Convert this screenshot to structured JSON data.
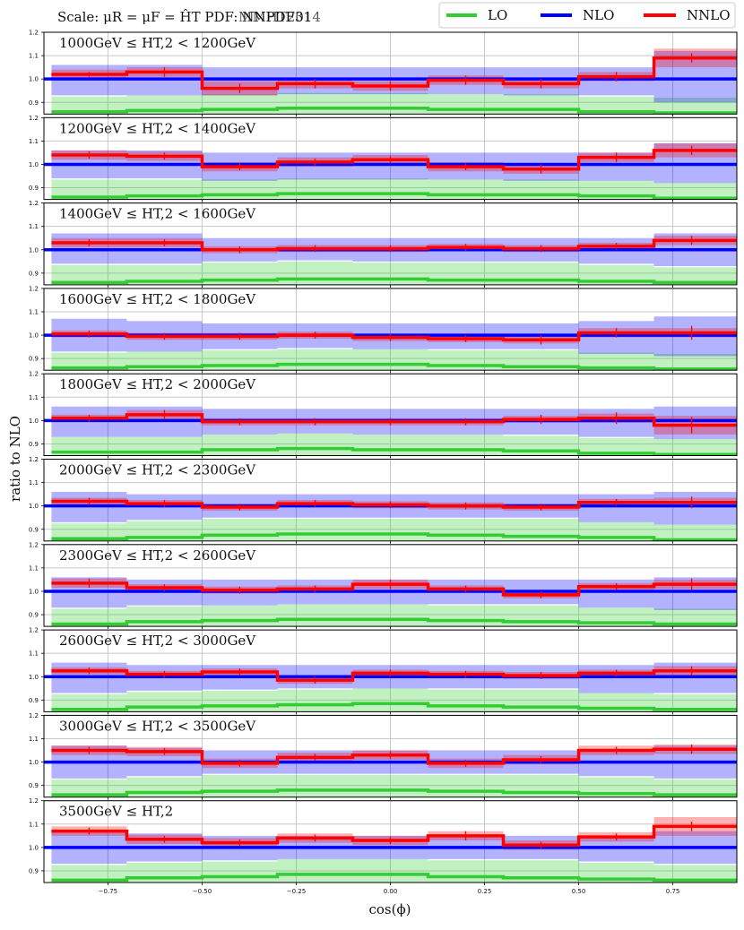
{
  "header": {
    "scale_text": "Scale: μR = μF = ĤT PDF: NNPDF31",
    "pdf_overlay": "MMHT2014"
  },
  "legend": {
    "placement": "top-right",
    "entries": [
      {
        "label": "LO",
        "color": "#33cc33"
      },
      {
        "label": "NLO",
        "color": "#0000ff"
      },
      {
        "label": "NNLO",
        "color": "#ff0000"
      }
    ]
  },
  "chart_data": {
    "type": "line",
    "xlabel": "cos(ϕ)",
    "ylabel": "ratio to NLO",
    "xlim": [
      -0.92,
      0.92
    ],
    "ylim": [
      0.85,
      1.2
    ],
    "yticks": [
      0.9,
      1.0,
      1.1,
      1.2
    ],
    "xticks": [
      -0.75,
      -0.5,
      -0.25,
      0.0,
      0.25,
      0.5,
      0.75
    ],
    "xtick_labels": [
      "−0.75",
      "−0.50",
      "−0.25",
      "0.00",
      "0.25",
      "0.50",
      "0.75"
    ],
    "grid": true,
    "bin_edges": [
      -0.9,
      -0.7,
      -0.5,
      -0.3,
      -0.1,
      0.1,
      0.3,
      0.5,
      0.7,
      0.92
    ],
    "bin_centers": [
      -0.8,
      -0.6,
      -0.4,
      -0.2,
      0.0,
      0.2,
      0.4,
      0.6,
      0.8
    ],
    "panels": [
      {
        "label": "1000GeV ≤ HT,2 < 1200GeV",
        "lo": [
          0.86,
          0.865,
          0.87,
          0.875,
          0.875,
          0.87,
          0.87,
          0.86,
          0.855
        ],
        "nlo_band_lo": [
          0.93,
          0.93,
          0.93,
          0.935,
          0.935,
          0.935,
          0.93,
          0.93,
          0.9
        ],
        "nlo_band_hi": [
          1.06,
          1.06,
          1.05,
          1.05,
          1.05,
          1.05,
          1.05,
          1.05,
          1.12
        ],
        "nnlo": [
          1.02,
          1.03,
          0.96,
          0.98,
          0.97,
          0.995,
          0.98,
          1.01,
          1.09
        ],
        "nnlo_err": [
          0.01,
          0.02,
          0.02,
          0.02,
          0.02,
          0.02,
          0.02,
          0.02,
          0.02
        ],
        "nnlo_band": [
          0.02,
          0.02,
          0.03,
          0.02,
          0.02,
          0.02,
          0.02,
          0.02,
          0.04
        ]
      },
      {
        "label": "1200GeV ≤ HT,2 < 1400GeV",
        "lo": [
          0.86,
          0.865,
          0.87,
          0.875,
          0.875,
          0.87,
          0.87,
          0.865,
          0.855
        ],
        "nlo_band_lo": [
          0.94,
          0.94,
          0.93,
          0.935,
          0.935,
          0.935,
          0.93,
          0.93,
          0.92
        ],
        "nlo_band_hi": [
          1.06,
          1.06,
          1.05,
          1.05,
          1.05,
          1.05,
          1.05,
          1.05,
          1.09
        ],
        "nnlo": [
          1.04,
          1.035,
          0.99,
          1.01,
          1.02,
          0.99,
          0.98,
          1.03,
          1.06
        ],
        "nnlo_err": [
          0.015,
          0.015,
          0.015,
          0.015,
          0.015,
          0.015,
          0.02,
          0.02,
          0.02
        ],
        "nnlo_band": [
          0.02,
          0.02,
          0.02,
          0.02,
          0.02,
          0.02,
          0.02,
          0.02,
          0.03
        ]
      },
      {
        "label": "1400GeV ≤ HT,2 < 1600GeV",
        "lo": [
          0.86,
          0.865,
          0.87,
          0.875,
          0.875,
          0.87,
          0.87,
          0.865,
          0.86
        ],
        "nlo_band_lo": [
          0.94,
          0.94,
          0.95,
          0.955,
          0.95,
          0.95,
          0.95,
          0.94,
          0.93
        ],
        "nlo_band_hi": [
          1.07,
          1.07,
          1.05,
          1.05,
          1.05,
          1.05,
          1.05,
          1.05,
          1.07
        ],
        "nnlo": [
          1.03,
          1.03,
          1.0,
          1.005,
          1.005,
          1.01,
          1.005,
          1.015,
          1.04
        ],
        "nnlo_err": [
          0.015,
          0.015,
          0.015,
          0.015,
          0.015,
          0.015,
          0.015,
          0.015,
          0.02
        ],
        "nnlo_band": [
          0.02,
          0.02,
          0.015,
          0.015,
          0.015,
          0.015,
          0.015,
          0.015,
          0.02
        ]
      },
      {
        "label": "1600GeV ≤ HT,2 < 1800GeV",
        "lo": [
          0.86,
          0.865,
          0.87,
          0.875,
          0.875,
          0.87,
          0.865,
          0.86,
          0.855
        ],
        "nlo_band_lo": [
          0.93,
          0.93,
          0.94,
          0.945,
          0.94,
          0.94,
          0.94,
          0.92,
          0.91
        ],
        "nlo_band_hi": [
          1.07,
          1.06,
          1.05,
          1.05,
          1.05,
          1.05,
          1.05,
          1.06,
          1.08
        ],
        "nnlo": [
          1.005,
          0.995,
          0.995,
          1.0,
          0.99,
          0.985,
          0.98,
          1.01,
          1.01
        ],
        "nnlo_err": [
          0.015,
          0.015,
          0.015,
          0.015,
          0.015,
          0.015,
          0.02,
          0.02,
          0.03
        ],
        "nnlo_band": [
          0.015,
          0.015,
          0.015,
          0.015,
          0.015,
          0.015,
          0.015,
          0.02,
          0.02
        ]
      },
      {
        "label": "1800GeV ≤ HT,2 < 2000GeV",
        "lo": [
          0.865,
          0.865,
          0.875,
          0.88,
          0.875,
          0.875,
          0.87,
          0.86,
          0.855
        ],
        "nlo_band_lo": [
          0.93,
          0.93,
          0.94,
          0.945,
          0.94,
          0.94,
          0.94,
          0.93,
          0.92
        ],
        "nlo_band_hi": [
          1.06,
          1.06,
          1.05,
          1.05,
          1.05,
          1.05,
          1.05,
          1.05,
          1.06
        ],
        "nnlo": [
          1.01,
          1.025,
          0.995,
          0.995,
          0.995,
          0.995,
          1.005,
          1.01,
          0.98
        ],
        "nnlo_err": [
          0.015,
          0.02,
          0.015,
          0.015,
          0.015,
          0.015,
          0.02,
          0.025,
          0.035
        ],
        "nnlo_band": [
          0.015,
          0.02,
          0.015,
          0.015,
          0.015,
          0.015,
          0.015,
          0.02,
          0.04
        ]
      },
      {
        "label": "2000GeV ≤ HT,2 < 2300GeV",
        "lo": [
          0.86,
          0.865,
          0.875,
          0.88,
          0.88,
          0.875,
          0.87,
          0.865,
          0.855
        ],
        "nlo_band_lo": [
          0.93,
          0.94,
          0.95,
          0.95,
          0.95,
          0.95,
          0.95,
          0.93,
          0.92
        ],
        "nlo_band_hi": [
          1.06,
          1.05,
          1.05,
          1.05,
          1.05,
          1.05,
          1.05,
          1.05,
          1.06
        ],
        "nnlo": [
          1.02,
          1.01,
          0.995,
          1.01,
          1.005,
          1.0,
          0.995,
          1.015,
          1.015
        ],
        "nnlo_err": [
          0.015,
          0.015,
          0.015,
          0.015,
          0.015,
          0.015,
          0.015,
          0.015,
          0.025
        ],
        "nnlo_band": [
          0.015,
          0.015,
          0.015,
          0.015,
          0.015,
          0.015,
          0.015,
          0.015,
          0.02
        ]
      },
      {
        "label": "2300GeV ≤ HT,2 < 2600GeV",
        "lo": [
          0.86,
          0.87,
          0.875,
          0.88,
          0.88,
          0.875,
          0.87,
          0.865,
          0.86
        ],
        "nlo_band_lo": [
          0.93,
          0.94,
          0.94,
          0.945,
          0.945,
          0.945,
          0.945,
          0.93,
          0.92
        ],
        "nlo_band_hi": [
          1.06,
          1.05,
          1.05,
          1.05,
          1.05,
          1.05,
          1.05,
          1.05,
          1.06
        ],
        "nnlo": [
          1.035,
          1.015,
          1.005,
          1.01,
          1.03,
          1.01,
          0.985,
          1.02,
          1.03
        ],
        "nnlo_err": [
          0.02,
          0.015,
          0.015,
          0.015,
          0.02,
          0.015,
          0.015,
          0.015,
          0.025
        ],
        "nnlo_band": [
          0.02,
          0.015,
          0.015,
          0.015,
          0.02,
          0.015,
          0.015,
          0.015,
          0.02
        ]
      },
      {
        "label": "2600GeV ≤ HT,2 < 3000GeV",
        "lo": [
          0.86,
          0.87,
          0.875,
          0.88,
          0.885,
          0.875,
          0.87,
          0.865,
          0.86
        ],
        "nlo_band_lo": [
          0.93,
          0.94,
          0.945,
          0.95,
          0.95,
          0.95,
          0.95,
          0.93,
          0.93
        ],
        "nlo_band_hi": [
          1.06,
          1.05,
          1.05,
          1.05,
          1.05,
          1.05,
          1.05,
          1.05,
          1.06
        ],
        "nnlo": [
          1.025,
          1.01,
          1.02,
          0.985,
          1.015,
          1.01,
          1.005,
          1.015,
          1.025
        ],
        "nnlo_err": [
          0.015,
          0.015,
          0.015,
          0.015,
          0.015,
          0.015,
          0.015,
          0.015,
          0.02
        ],
        "nnlo_band": [
          0.015,
          0.015,
          0.015,
          0.015,
          0.015,
          0.015,
          0.015,
          0.015,
          0.02
        ]
      },
      {
        "label": "3000GeV ≤ HT,2 < 3500GeV",
        "lo": [
          0.86,
          0.87,
          0.875,
          0.88,
          0.88,
          0.875,
          0.87,
          0.865,
          0.86
        ],
        "nlo_band_lo": [
          0.93,
          0.94,
          0.95,
          0.95,
          0.95,
          0.95,
          0.95,
          0.94,
          0.93
        ],
        "nlo_band_hi": [
          1.07,
          1.06,
          1.05,
          1.05,
          1.05,
          1.05,
          1.05,
          1.05,
          1.07
        ],
        "nnlo": [
          1.05,
          1.045,
          0.995,
          1.02,
          1.03,
          0.995,
          1.01,
          1.05,
          1.055
        ],
        "nnlo_err": [
          0.015,
          0.015,
          0.015,
          0.015,
          0.015,
          0.015,
          0.015,
          0.015,
          0.02
        ],
        "nnlo_band": [
          0.02,
          0.02,
          0.02,
          0.02,
          0.02,
          0.02,
          0.02,
          0.02,
          0.02
        ]
      },
      {
        "label": "3500GeV ≤ HT,2",
        "lo": [
          0.86,
          0.87,
          0.875,
          0.885,
          0.885,
          0.875,
          0.87,
          0.865,
          0.86
        ],
        "nlo_band_lo": [
          0.93,
          0.94,
          0.945,
          0.95,
          0.95,
          0.95,
          0.95,
          0.94,
          0.93
        ],
        "nlo_band_hi": [
          1.07,
          1.06,
          1.05,
          1.05,
          1.05,
          1.05,
          1.05,
          1.05,
          1.07
        ],
        "nnlo": [
          1.07,
          1.035,
          1.02,
          1.04,
          1.03,
          1.05,
          1.01,
          1.045,
          1.09
        ],
        "nnlo_err": [
          0.015,
          0.015,
          0.015,
          0.015,
          0.015,
          0.02,
          0.015,
          0.015,
          0.02
        ],
        "nnlo_band": [
          0.02,
          0.02,
          0.02,
          0.02,
          0.02,
          0.02,
          0.02,
          0.02,
          0.04
        ]
      }
    ]
  }
}
